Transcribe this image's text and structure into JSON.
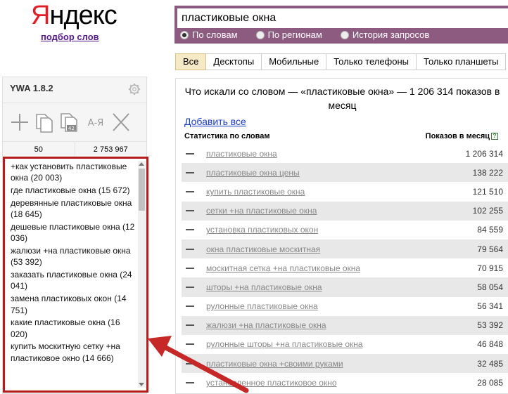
{
  "logo": {
    "first": "Я",
    "rest": "ндекс",
    "subtitle": "подбор слов"
  },
  "search": {
    "value": "пластиковые окна",
    "modes": [
      {
        "label": "По словам",
        "selected": true
      },
      {
        "label": "По регионам",
        "selected": false
      },
      {
        "label": "История запросов",
        "selected": false
      }
    ]
  },
  "tabs": [
    "Все",
    "Десктопы",
    "Мобильные",
    "Только телефоны",
    "Только планшеты"
  ],
  "results": {
    "title": "Что искали со словом  —  «пластиковые окна» — 1 206 314 показов в месяц",
    "add_all": "Добавить все",
    "col_query": "Статистика по словам",
    "col_count": "Показов в месяц",
    "help": "?",
    "rows": [
      {
        "q": "пластиковые окна",
        "c": "1 206 314"
      },
      {
        "q": "пластиковые окна цены",
        "c": "138 222"
      },
      {
        "q": "купить пластиковые окна",
        "c": "121 510"
      },
      {
        "q": "сетки +на пластиковые окна",
        "c": "102 255"
      },
      {
        "q": "установка пластиковых окон",
        "c": "84 559"
      },
      {
        "q": "окна пластиковые москитная",
        "c": "79 564"
      },
      {
        "q": "москитная сетка +на пластиковые окна",
        "c": "70 915"
      },
      {
        "q": "шторы +на пластиковые окна",
        "c": "58 054"
      },
      {
        "q": "рулонные пластиковые окна",
        "c": "56 341"
      },
      {
        "q": "жалюзи +на пластиковые окна",
        "c": "53 392"
      },
      {
        "q": "рулонные шторы +на пластиковые окна",
        "c": "46 848"
      },
      {
        "q": "пластиковые окна +своими руками",
        "c": "32 485"
      },
      {
        "q": "установленное пластиковое окно",
        "c": "28 085"
      }
    ]
  },
  "panel": {
    "title": "YWA 1.8.2",
    "count_left": "50",
    "count_right": "2 753 967",
    "items": [
      "+как установить пластиковые окна (20 003)",
      "где пластиковые окна (15 672)",
      "деревянные пластиковые окна (18 645)",
      "дешевые пластиковые окна (12 036)",
      "жалюзи +на пластиковые окна (53 392)",
      "заказать пластиковые окна (24 041)",
      "замена пластиковых окон (14 751)",
      "какие пластиковые окна (16 020)",
      "купить москитную сетку +на пластиковое окно (14 666)"
    ],
    "sort_label": "А-Я",
    "copy_badge": "42"
  },
  "colors": {
    "accent": "#8d5b80",
    "highlight": "#b71c1c",
    "logo_red": "#e31e24"
  }
}
